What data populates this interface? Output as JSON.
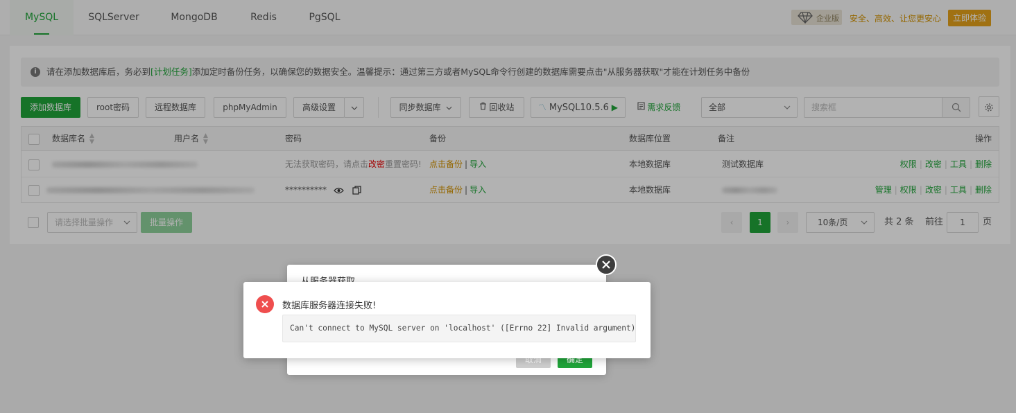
{
  "tabs": [
    {
      "label": "MySQL",
      "active": true
    },
    {
      "label": "SQLServer"
    },
    {
      "label": "MongoDB"
    },
    {
      "label": "Redis"
    },
    {
      "label": "PgSQL"
    }
  ],
  "enterprise": {
    "badge": "企业版",
    "slogan": "安全、高效、让您更安心",
    "try_button": "立即体验",
    "badge_icon": "diamond-icon",
    "accent": "#e5a21b"
  },
  "alert": {
    "icon": "info-icon",
    "part1": "请在添加数据库后，务必到",
    "link": "[计划任务]",
    "part2": "添加定时备份任务，以确保您的数据安全。温馨提示：通过第三方或者MySQL命令行创建的数据库需要点击\"从服务器获取\"才能在计划任务中备份"
  },
  "toolbar": {
    "add_db": "添加数据库",
    "root_pwd": "root密码",
    "remote_db": "远程数据库",
    "phpmyadmin": "phpMyAdmin",
    "advanced": "高级设置",
    "sync_db": "同步数据库",
    "recycle": "回收站",
    "mysql_version": "MySQL10.5.6",
    "feedback": "需求反馈",
    "filter_value": "全部",
    "search_placeholder": "搜索框"
  },
  "table": {
    "headers": {
      "name": "数据库名",
      "user": "用户名",
      "password": "密码",
      "backup": "备份",
      "location": "数据库位置",
      "note": "备注",
      "ops": "操作"
    },
    "rows": [
      {
        "pwd_part1": "无法获取密码，请点击",
        "pwd_link": "改密",
        "pwd_part2": "重置密码!",
        "backup": "点击备份",
        "import": "导入",
        "location": "本地数据库",
        "note": "测试数据库",
        "ops": [
          "权限",
          "改密",
          "工具",
          "删除"
        ]
      },
      {
        "password": "**********",
        "backup": "点击备份",
        "import": "导入",
        "location": "本地数据库",
        "note": "",
        "ops": [
          "管理",
          "权限",
          "改密",
          "工具",
          "删除"
        ]
      }
    ]
  },
  "batch": {
    "select_placeholder": "请选择批量操作",
    "button": "批量操作"
  },
  "pagination": {
    "current": "1",
    "per_page": "10条/页",
    "total": "共 2 条",
    "goto_label": "前往",
    "goto_value": "1",
    "page_suffix": "页"
  },
  "dialog": {
    "title": "从服务器获取",
    "cancel": "取消",
    "ok": "确定"
  },
  "message": {
    "title": "数据库服务器连接失败!",
    "detail": "Can't connect to MySQL server on 'localhost' ([Errno 22] Invalid argument)",
    "icon": "error-icon",
    "color": "#ef4e4e"
  }
}
